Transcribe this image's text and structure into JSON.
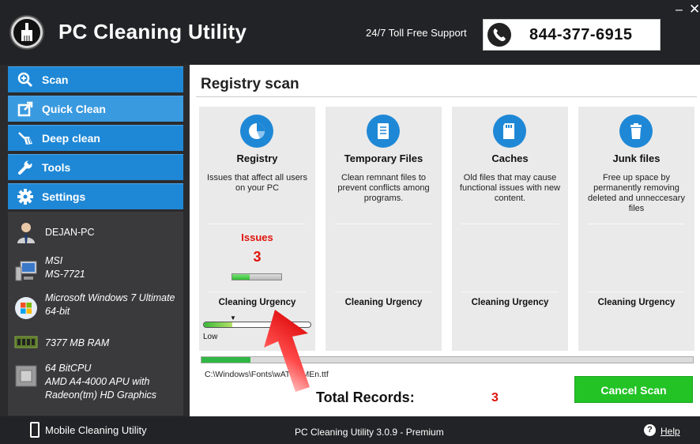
{
  "header": {
    "title": "PC Cleaning Utility",
    "support_text": "24/7 Toll Free Support",
    "phone": "844-377-6915",
    "minimize": "–",
    "close": "✕"
  },
  "sidebar": {
    "items": [
      {
        "label": "Scan",
        "icon": "magnify-plus-icon"
      },
      {
        "label": "Quick Clean",
        "icon": "external-link-icon"
      },
      {
        "label": "Deep clean",
        "icon": "broom-icon"
      },
      {
        "label": "Tools",
        "icon": "wrench-icon"
      },
      {
        "label": "Settings",
        "icon": "gear-icon"
      }
    ],
    "active": "Quick Clean"
  },
  "system": {
    "pc_name": "DEJAN-PC",
    "model_line1": "MSI",
    "model_line2": "MS-7721",
    "os_line1": "Microsoft Windows 7 Ultimate",
    "os_line2": "64-bit",
    "ram": "7377 MB RAM",
    "cpu_line1": "64 BitCPU",
    "cpu_line2": "AMD A4-4000 APU with",
    "cpu_line3": "Radeon(tm) HD Graphics"
  },
  "main": {
    "title": "Registry scan",
    "cards": [
      {
        "title": "Registry",
        "desc": "Issues that affect all users on your PC",
        "urgency": "Cleaning Urgency"
      },
      {
        "title": "Temporary Files",
        "desc": "Clean remnant files to prevent conflicts among programs.",
        "urgency": "Cleaning Urgency"
      },
      {
        "title": "Caches",
        "desc": "Old files that may cause functional issues with new content.",
        "urgency": "Cleaning Urgency"
      },
      {
        "title": "Junk files",
        "desc": "Free up space by permanently removing deleted and unneccesary files",
        "urgency": "Cleaning Urgency"
      }
    ],
    "issues_label": "Issues",
    "issues_count": "3",
    "issues_bar_fraction": 0.35,
    "urgency_marker": "▼",
    "urgency_fraction": 0.27,
    "urgency_low": "Low",
    "progress_fraction": 0.1,
    "scan_path": "C:\\Windows\\Fonts\\wATCHMEn.ttf",
    "total_label": "Total Records:",
    "total_value": "3",
    "cancel_label": "Cancel Scan"
  },
  "footer": {
    "mobile_label": "Mobile Cleaning Utility",
    "version": "PC Cleaning Utility 3.0.9 - Premium",
    "help_icon": "?",
    "help": "Help"
  },
  "colors": {
    "accent_blue": "#1f88d6",
    "cancel_green": "#23c326",
    "alert_red": "#e0140b",
    "dark_bg": "#222326"
  }
}
